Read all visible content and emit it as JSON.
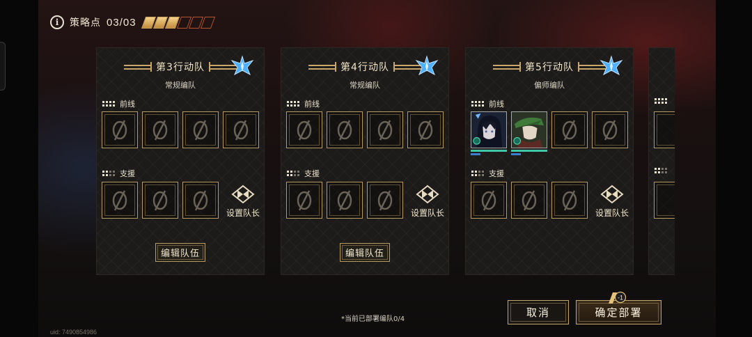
{
  "top": {
    "info_icon": "info-icon",
    "strategy_label": "策略点",
    "strategy_value": "03/03",
    "pips_filled": 3,
    "pips_total": 6
  },
  "teams": [
    {
      "name": "第3行动队",
      "type": "常规编队",
      "front_label": "前线",
      "support_label": "支援",
      "leader_label": "设置队长",
      "edit_label": "编辑队伍"
    },
    {
      "name": "第4行动队",
      "type": "常规编队",
      "front_label": "前线",
      "support_label": "支援",
      "leader_label": "设置队长",
      "edit_label": "编辑队伍"
    },
    {
      "name": "第5行动队",
      "type": "偏师编队",
      "front_label": "前线",
      "support_label": "支援",
      "leader_label": "设置队长"
    }
  ],
  "footer": {
    "deploy_status": "*当前已部署编队0/4",
    "uid": "uid: 7490854986",
    "cancel_label": "取消",
    "confirm_label": "确定部署",
    "confirm_cost": "-1"
  },
  "colors": {
    "gold": "#c9a76a",
    "emblem": "#4fb0ff",
    "hp_bar": "#3fc7a8"
  }
}
